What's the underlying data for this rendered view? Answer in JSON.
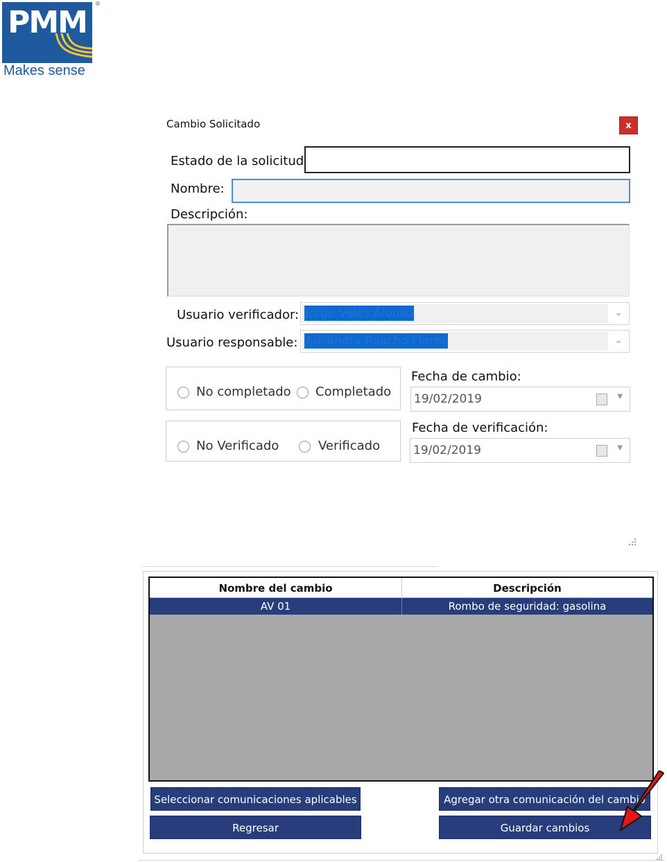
{
  "logo": {
    "brand": "PMM",
    "tagline": "Makes sense",
    "mark": "®"
  },
  "dialog": {
    "title": "Cambio Solicitado",
    "close_label": "x",
    "estado_label": "Estado de la solicitud:",
    "estado_value": "",
    "nombre_label": "Nombre:",
    "nombre_value": "",
    "descripcion_label": "Descripción:",
    "descripcion_value": "",
    "verificador_label": "Usuario verificador:",
    "verificador_value": "Jorge Velez Alonso",
    "responsable_label": "Usuario responsable:",
    "responsable_value": "Alejandra Roacho Flores",
    "estado_options": [
      "No completado",
      "Completado"
    ],
    "verificacion_options": [
      "No Verificado",
      "Verificado"
    ],
    "fecha_cambio_label": "Fecha de cambio:",
    "fecha_cambio_value": "19/02/2019",
    "fecha_verificacion_label": "Fecha de verificación:",
    "fecha_verificacion_value": "19/02/2019"
  },
  "grid": {
    "columns": [
      "Nombre del cambio",
      "Descripción"
    ],
    "rows": [
      {
        "nombre": "AV 01",
        "descripcion": "Rombo de seguridad: gasolina"
      }
    ]
  },
  "buttons": {
    "seleccionar": "Seleccionar comunicaciones aplicables",
    "agregar": "Agregar otra comunicación del cambio",
    "regresar": "Regresar",
    "guardar": "Guardar cambios"
  },
  "colors": {
    "brand_blue": "#1f5a9e",
    "button_navy": "#283e7c",
    "close_red": "#c9302c",
    "arrow_red": "#e8141a"
  }
}
